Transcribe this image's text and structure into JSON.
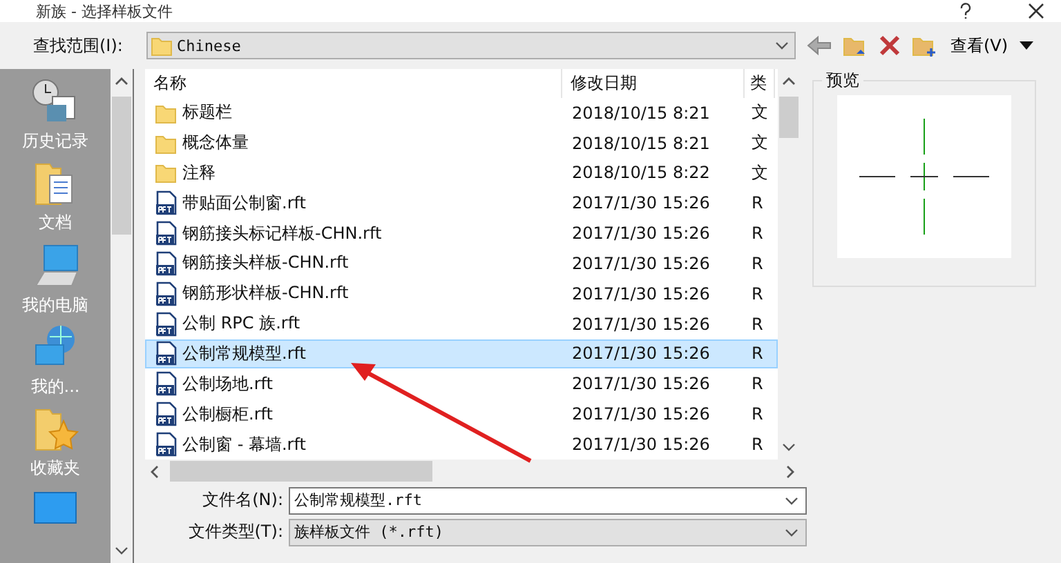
{
  "window": {
    "title": "新族 - 选择样板文件"
  },
  "toolbar": {
    "look_in_label": "查找范围(I):",
    "look_in_value": "Chinese",
    "view_menu": "查看(V)"
  },
  "places": [
    {
      "label": "历史记录",
      "kind": "history"
    },
    {
      "label": "文档",
      "kind": "documents"
    },
    {
      "label": "我的电脑",
      "kind": "computer"
    },
    {
      "label": "我的...",
      "kind": "network"
    },
    {
      "label": "收藏夹",
      "kind": "favorites"
    },
    {
      "kind": "desktop"
    }
  ],
  "file_list": {
    "columns": [
      "名称",
      "修改日期",
      "类"
    ],
    "rows": [
      {
        "name": "标题栏",
        "modified": "2018/10/15 8:21",
        "type": "文",
        "kind": "folder",
        "selected": false
      },
      {
        "name": "概念体量",
        "modified": "2018/10/15 8:21",
        "type": "文",
        "kind": "folder",
        "selected": false
      },
      {
        "name": "注释",
        "modified": "2018/10/15 8:22",
        "type": "文",
        "kind": "folder",
        "selected": false
      },
      {
        "name": "带贴面公制窗.rft",
        "modified": "2017/1/30 15:26",
        "type": "R",
        "kind": "rft",
        "selected": false
      },
      {
        "name": "钢筋接头标记样板-CHN.rft",
        "modified": "2017/1/30 15:26",
        "type": "R",
        "kind": "rft",
        "selected": false
      },
      {
        "name": "钢筋接头样板-CHN.rft",
        "modified": "2017/1/30 15:26",
        "type": "R",
        "kind": "rft",
        "selected": false
      },
      {
        "name": "钢筋形状样板-CHN.rft",
        "modified": "2017/1/30 15:26",
        "type": "R",
        "kind": "rft",
        "selected": false
      },
      {
        "name": "公制 RPC 族.rft",
        "modified": "2017/1/30 15:26",
        "type": "R",
        "kind": "rft",
        "selected": false
      },
      {
        "name": "公制常规模型.rft",
        "modified": "2017/1/30 15:26",
        "type": "R",
        "kind": "rft",
        "selected": true
      },
      {
        "name": "公制场地.rft",
        "modified": "2017/1/30 15:26",
        "type": "R",
        "kind": "rft",
        "selected": false
      },
      {
        "name": "公制橱柜.rft",
        "modified": "2017/1/30 15:26",
        "type": "R",
        "kind": "rft",
        "selected": false
      },
      {
        "name": "公制窗 - 幕墙.rft",
        "modified": "2017/1/30 15:26",
        "type": "R",
        "kind": "rft",
        "selected": false
      }
    ]
  },
  "preview": {
    "title": "预览"
  },
  "file_name": {
    "label": "文件名(N):",
    "value": "公制常规模型.rft"
  },
  "file_type": {
    "label": "文件类型(T):",
    "value": "族样板文件 (*.rft)"
  }
}
